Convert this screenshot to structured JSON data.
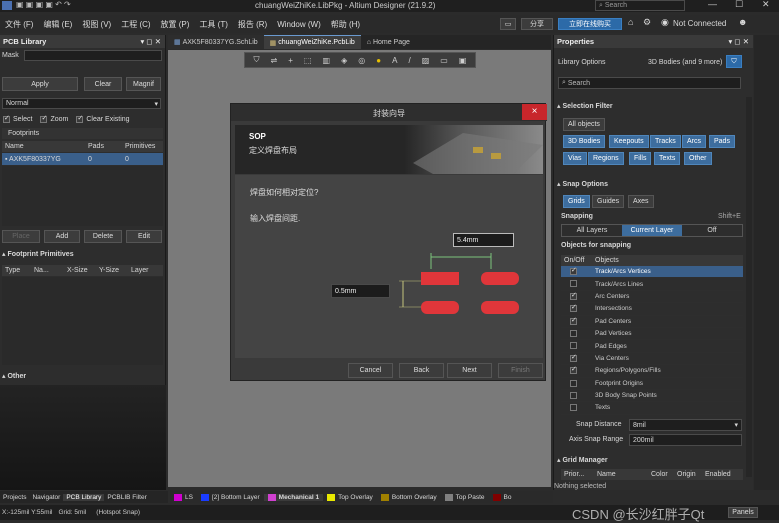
{
  "title_bar": {
    "title": "chuangWeiZhiKe.LibPkg - Altium Designer (21.9.2)",
    "search_placeholder": "Search"
  },
  "menu": [
    "文件 (F)",
    "编辑 (E)",
    "视图 (V)",
    "工程 (C)",
    "放置 (P)",
    "工具 (T)",
    "报告 (R)",
    "Window (W)",
    "帮助 (H)"
  ],
  "menu_right": {
    "share": "分享",
    "buy": "立即在线购买",
    "connection": "Not Connected"
  },
  "tabs": [
    {
      "label": "AXK5F80337YG.SchLib"
    },
    {
      "label": "chuangWeiZhiKe.PcbLib"
    },
    {
      "label": "Home Page"
    }
  ],
  "pcb_library": {
    "title": "PCB Library",
    "mask_label": "Mask",
    "apply": "Apply",
    "clear": "Clear",
    "magnify": "Magnif",
    "mode": "Normal",
    "opts": [
      "Select",
      "Zoom",
      "Clear Existing"
    ],
    "footprints_label": "Footprints",
    "columns": [
      "Name",
      "Pads",
      "Primitives"
    ],
    "rows": [
      {
        "name": "AXK5F80337YG",
        "pads": "0",
        "primitives": "0"
      }
    ],
    "place": "Place",
    "add": "Add",
    "delete": "Delete",
    "edit": "Edit",
    "primitives_label": "Footprint Primitives",
    "prim_cols": [
      "Type",
      "Na...",
      "X-Size",
      "Y-Size",
      "Layer"
    ],
    "other_label": "Other"
  },
  "bottom_tabs": [
    "Projects",
    "Navigator",
    "PCB Library",
    "PCBLIB Filter"
  ],
  "layers": [
    {
      "label": "LS",
      "color": "#d000d0"
    },
    {
      "label": "[2] Bottom Layer",
      "color": "#1a3cff"
    },
    {
      "label": "Mechanical 1",
      "color": "#d040d0"
    },
    {
      "label": "Top Overlay",
      "color": "#e8e800"
    },
    {
      "label": "Bottom Overlay",
      "color": "#a08000"
    },
    {
      "label": "Top Paste",
      "color": "#808080"
    },
    {
      "label": "Bo",
      "color": "#800000"
    }
  ],
  "status": {
    "coords": "X:-125mil Y:55mil",
    "grid": "Grid: 5mil",
    "snap": "(Hotspot Snap)",
    "panels": "Panels",
    "watermark": "CSDN @长沙红胖子Qt"
  },
  "dialog": {
    "title": "封装向导",
    "section": "SOP",
    "subtitle": "定义焊盘布局",
    "q1": "焊盘如何相对定位?",
    "q2": "输入焊盘间距.",
    "hspacing": "5.4mm",
    "vspacing": "0.5mm",
    "cancel": "Cancel",
    "back": "Back",
    "next": "Next",
    "finish": "Finish",
    "close": "×"
  },
  "properties": {
    "title": "Properties",
    "library_options": "Library Options",
    "bodies": "3D Bodies (and 9 more)",
    "search": "Search",
    "selection_filter": "Selection Filter",
    "all_objects": "All objects",
    "filter_items": [
      "3D Bodies",
      "Keepouts",
      "Tracks",
      "Arcs",
      "Pads",
      "Vias",
      "Regions",
      "Fills",
      "Texts",
      "Other"
    ],
    "snap_options": "Snap Options",
    "snap_btns": [
      "Grids",
      "Guides",
      "Axes"
    ],
    "snapping": "Snapping",
    "shortcut": "Shift+E",
    "snap_layers": [
      "All Layers",
      "Current Layer",
      "Off"
    ],
    "objects_for_snapping": "Objects for snapping",
    "snap_cols": [
      "On/Off",
      "Objects"
    ],
    "snap_objects": [
      {
        "name": "Track/Arcs Vertices",
        "on": true
      },
      {
        "name": "Track/Arcs Lines",
        "on": false
      },
      {
        "name": "Arc Centers",
        "on": true
      },
      {
        "name": "Intersections",
        "on": true
      },
      {
        "name": "Pad Centers",
        "on": true
      },
      {
        "name": "Pad Vertices",
        "on": false
      },
      {
        "name": "Pad Edges",
        "on": false
      },
      {
        "name": "Via Centers",
        "on": true
      },
      {
        "name": "Regions/Polygons/Fills",
        "on": true
      },
      {
        "name": "Footprint Origins",
        "on": false
      },
      {
        "name": "3D Body Snap Points",
        "on": false
      },
      {
        "name": "Texts",
        "on": false
      }
    ],
    "snap_distance_label": "Snap Distance",
    "snap_distance": "8mil",
    "axis_snap_label": "Axis Snap Range",
    "axis_snap": "200mil",
    "grid_manager": "Grid Manager",
    "grid_cols": [
      "Prior...",
      "Name",
      "Color",
      "Origin",
      "Enabled"
    ],
    "nothing_selected": "Nothing selected"
  }
}
